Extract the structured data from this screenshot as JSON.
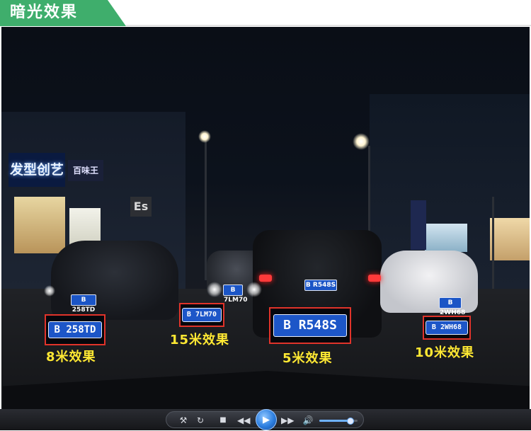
{
  "header": {
    "title": "暗光效果",
    "accent_color": "#3fae6c"
  },
  "scene": {
    "signs": {
      "salon": "发型创艺",
      "shop": "百味王",
      "es": "Es"
    },
    "car_plates": {
      "center": "B R548S",
      "mid": "B 7LM70",
      "right": "B 2WH68",
      "left": "B 258TD"
    }
  },
  "zooms": [
    {
      "plate": "B 258TD",
      "caption": "8米效果"
    },
    {
      "plate": "B 7LM70",
      "caption": "15米效果"
    },
    {
      "plate": "B R548S",
      "caption": "5米效果"
    },
    {
      "plate": "B 2WH68",
      "caption": "10米效果"
    }
  ],
  "player": {
    "icons": [
      "tools-icon",
      "repeat-icon",
      "stop-icon",
      "previous-icon",
      "play-icon",
      "next-icon",
      "volume-icon"
    ],
    "volume": 0.8,
    "caption_color": "#ffe833",
    "callout_border_color": "#e0332a"
  }
}
